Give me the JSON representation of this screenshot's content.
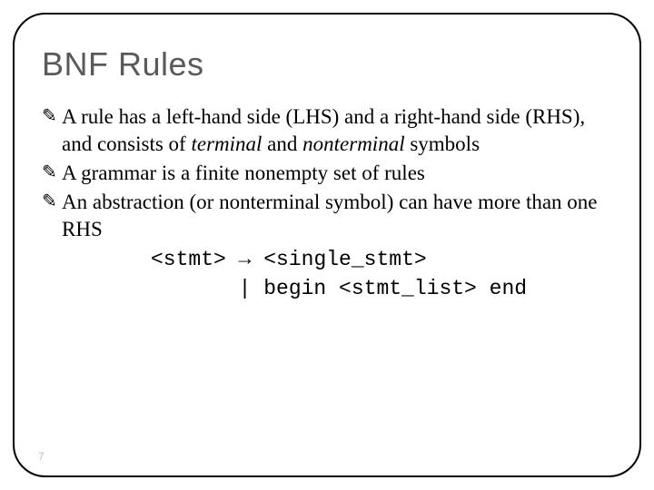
{
  "title": "BNF Rules",
  "bullets": [
    {
      "pre": "A rule has a left-hand side (LHS) and a right-hand side (RHS), and consists of ",
      "em1": "terminal",
      "mid": " and ",
      "em2": "nonterminal",
      "post": " symbols"
    },
    {
      "text": "A grammar is a finite nonempty set of rules"
    },
    {
      "text": "An abstraction (or nonterminal symbol) can have more than one RHS"
    }
  ],
  "code": {
    "line1_left": "<stmt> ",
    "arrow": "→",
    "line1_right": " <single_stmt>",
    "line2": "       | begin <stmt_list> end"
  },
  "page_number": "7"
}
